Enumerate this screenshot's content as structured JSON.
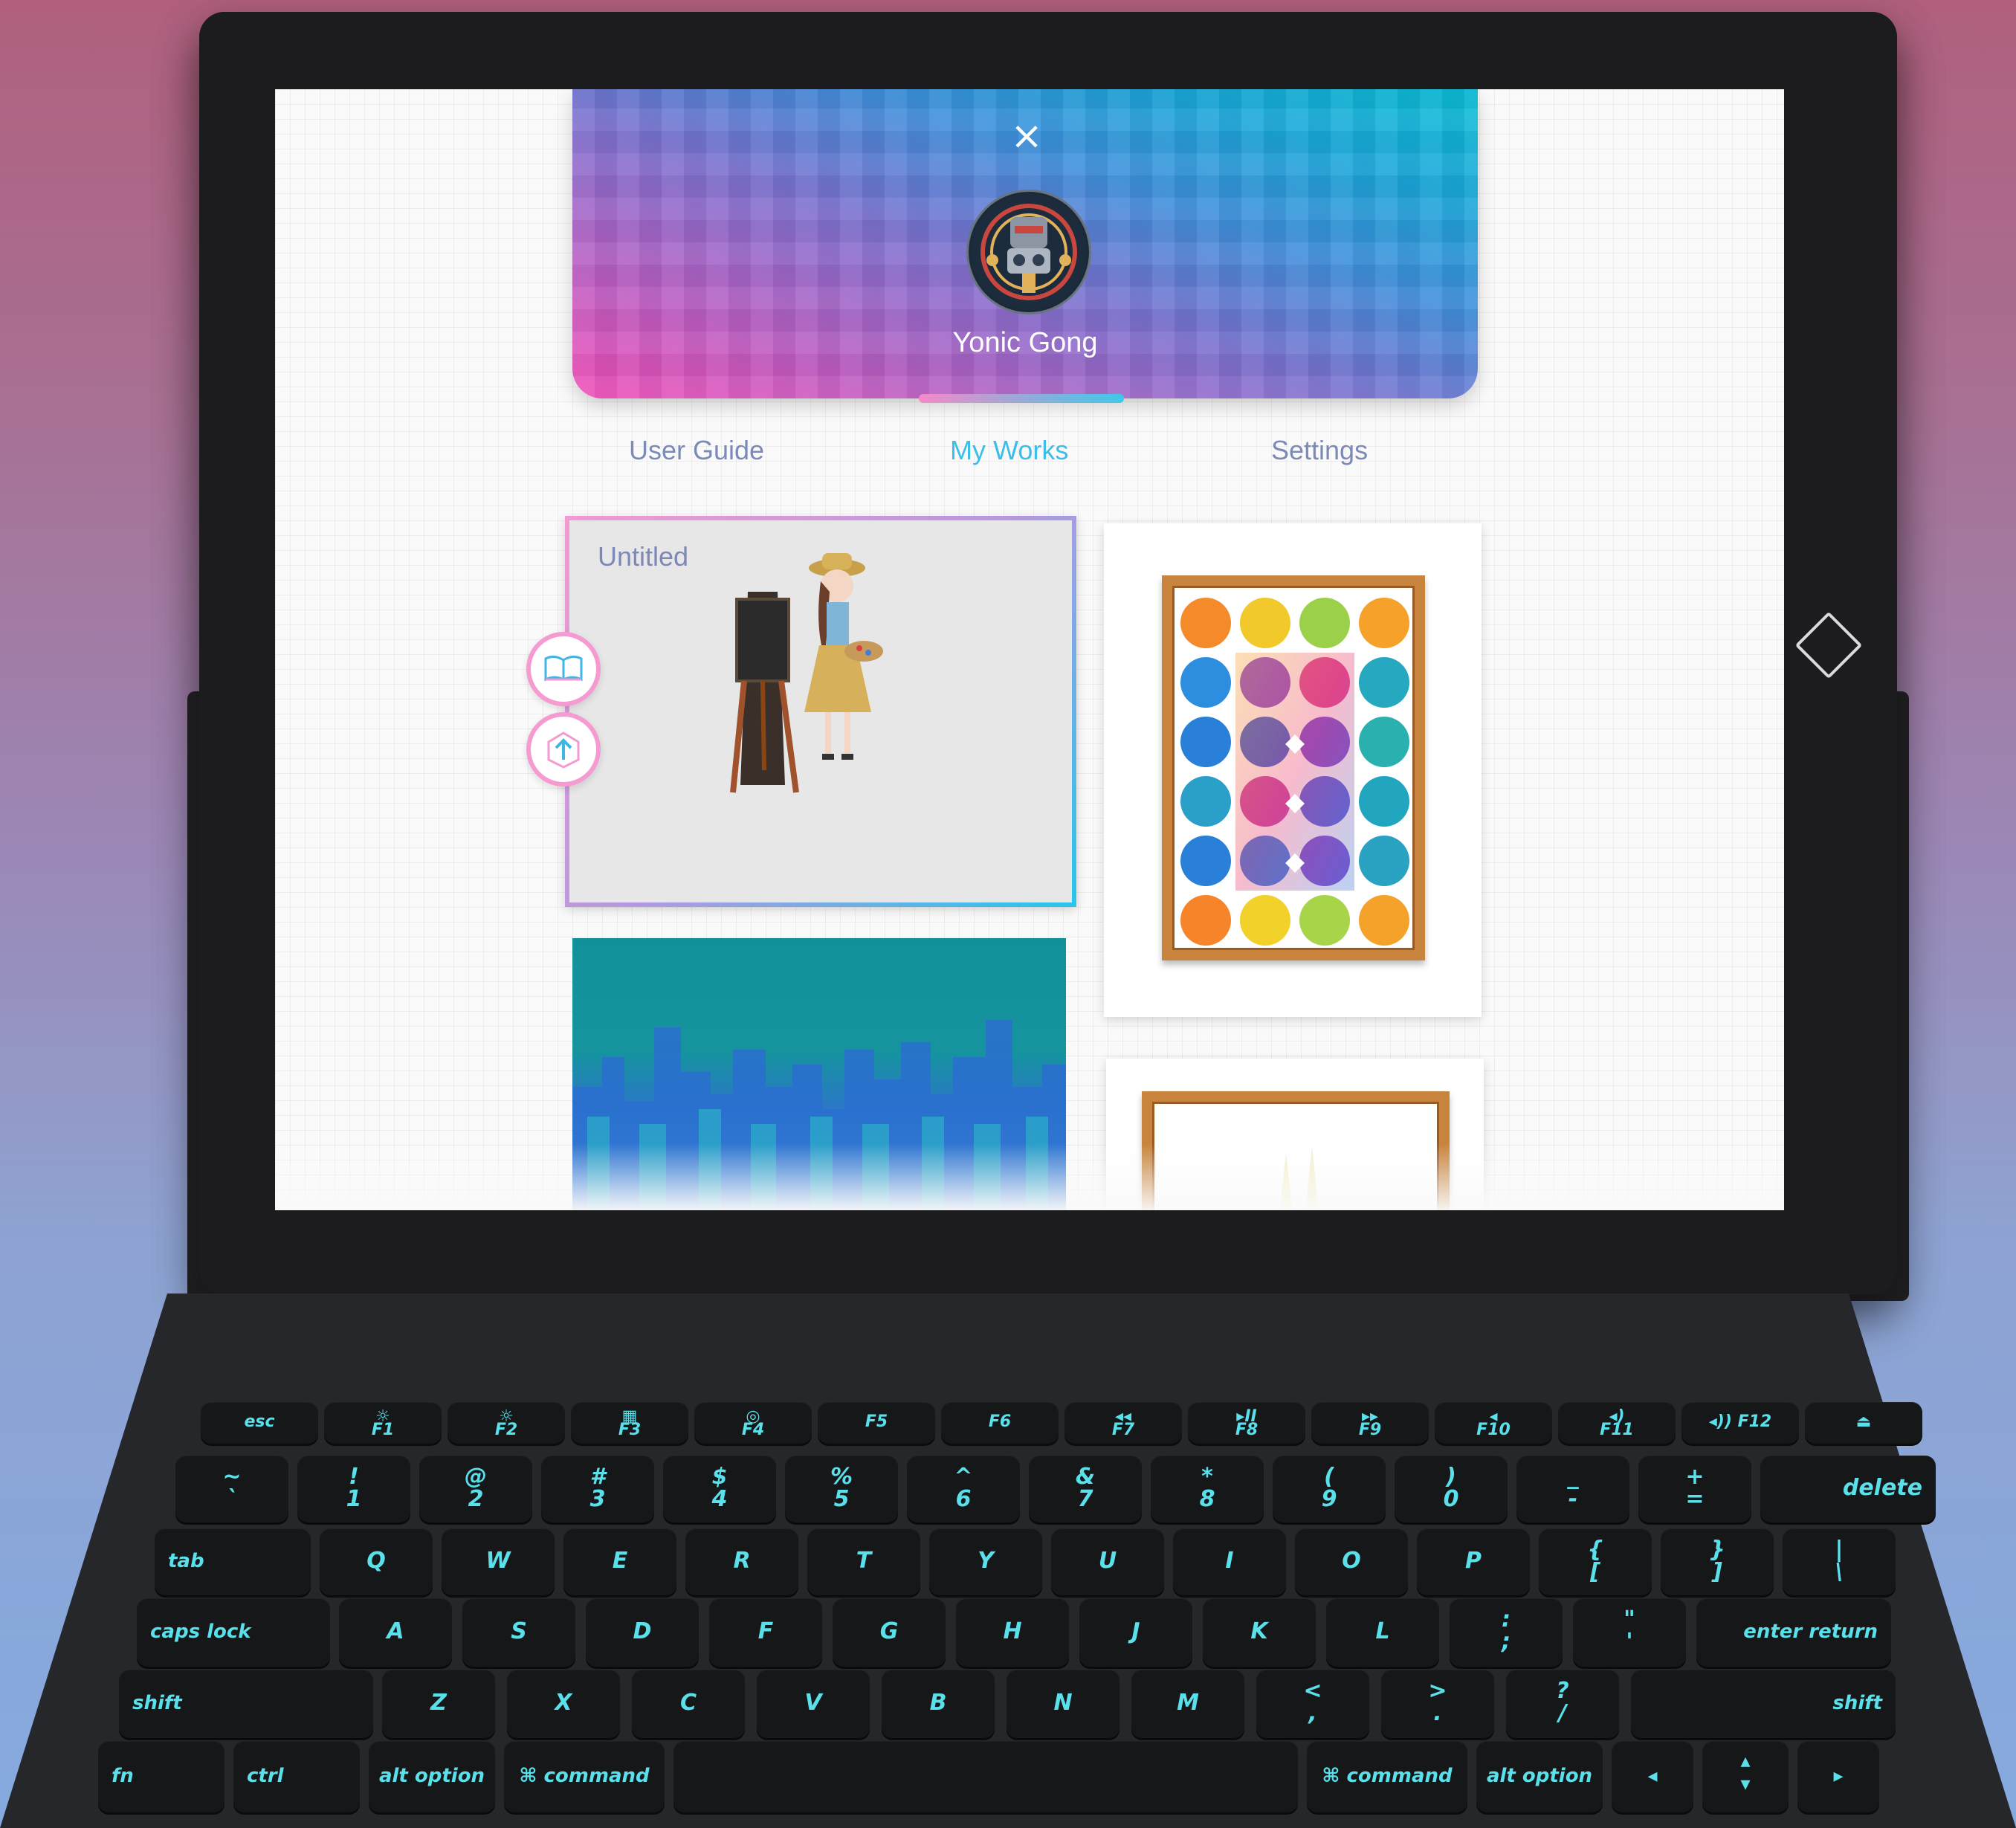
{
  "profile": {
    "close_label": "×",
    "username": "Yonic Gong"
  },
  "tabs": [
    {
      "label": "User Guide",
      "active": false
    },
    {
      "label": "My Works",
      "active": true
    },
    {
      "label": "Settings",
      "active": false
    }
  ],
  "works": {
    "selected_title": "Untitled"
  },
  "icons": {
    "close": "close-icon",
    "open_book": "open-book-icon",
    "upload": "upload-icon",
    "home": "home-diamond-icon"
  },
  "colors": {
    "accent_cyan": "#3bbfea",
    "accent_pink": "#f59bd2",
    "tab_inactive": "#7c8ab8",
    "key_glow": "#59e0ea"
  },
  "keyboard": {
    "fn_row": [
      "esc",
      "☼ F1",
      "☼ F2",
      "▦ F3",
      "◎ F4",
      "F5",
      "F6",
      "◂◂ F7",
      "▸II F8",
      "▸▸ F9",
      "◂ F10",
      "◂) F11",
      "◂)) F12",
      "⏏"
    ],
    "number_row": [
      {
        "top": "~",
        "bottom": "`"
      },
      {
        "top": "!",
        "bottom": "1"
      },
      {
        "top": "@",
        "bottom": "2"
      },
      {
        "top": "#",
        "bottom": "3"
      },
      {
        "top": "$",
        "bottom": "4"
      },
      {
        "top": "%",
        "bottom": "5"
      },
      {
        "top": "^",
        "bottom": "6"
      },
      {
        "top": "&",
        "bottom": "7"
      },
      {
        "top": "*",
        "bottom": "8"
      },
      {
        "top": "(",
        "bottom": "9"
      },
      {
        "top": ")",
        "bottom": "0"
      },
      {
        "top": "_",
        "bottom": "-"
      },
      {
        "top": "+",
        "bottom": "="
      },
      {
        "top": "",
        "bottom": "delete"
      }
    ],
    "qwerty_row": [
      "tab",
      "Q",
      "W",
      "E",
      "R",
      "T",
      "Y",
      "U",
      "I",
      "O",
      "P",
      "{ [",
      "} ]",
      "| \\"
    ],
    "home_row": [
      "caps lock",
      "A",
      "S",
      "D",
      "F",
      "G",
      "H",
      "J",
      "K",
      "L",
      ": ;",
      "\" '",
      "enter return"
    ],
    "shift_row": [
      "shift",
      "Z",
      "X",
      "C",
      "V",
      "B",
      "N",
      "M",
      "< ,",
      "> .",
      "? /",
      "shift"
    ],
    "bottom_row": [
      "fn",
      "ctrl",
      "alt option",
      "⌘ command",
      "",
      "⌘ command",
      "alt option",
      "◂",
      "▴ ▾",
      "▸"
    ]
  }
}
